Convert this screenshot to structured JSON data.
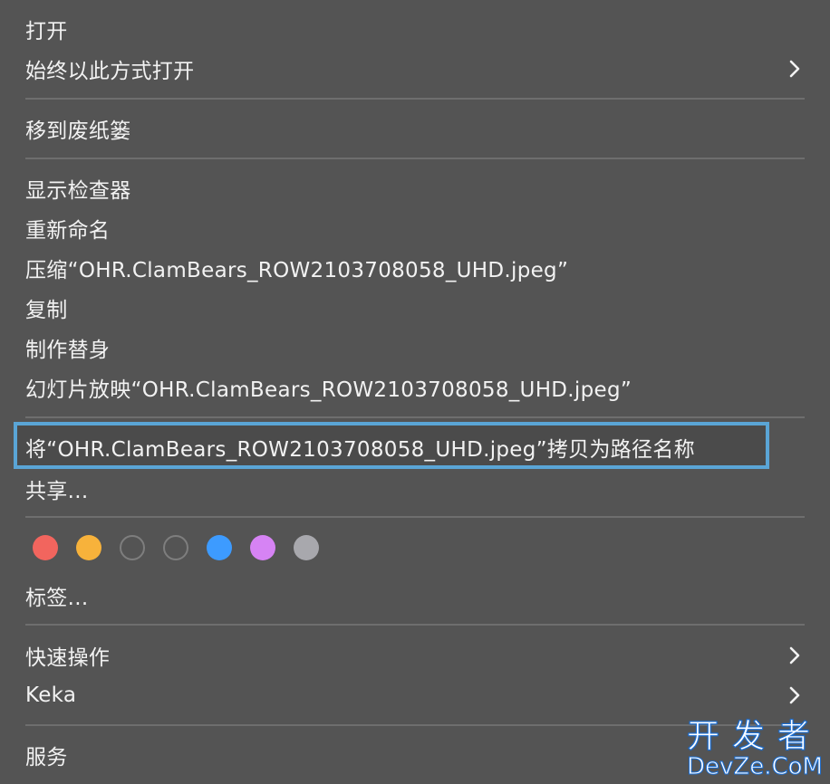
{
  "menu": {
    "items": [
      {
        "label": "打开"
      },
      {
        "label": "始终以此方式打开",
        "submenu": true
      },
      {
        "label": "移到废纸篓"
      },
      {
        "label": "显示检查器"
      },
      {
        "label": "重新命名"
      },
      {
        "label": "压缩“OHR.ClamBears_ROW2103708058_UHD.jpeg”"
      },
      {
        "label": "复制"
      },
      {
        "label": "制作替身"
      },
      {
        "label": "幻灯片放映“OHR.ClamBears_ROW2103708058_UHD.jpeg”"
      },
      {
        "label": "将“OHR.ClamBears_ROW2103708058_UHD.jpeg”拷贝为路径名称",
        "highlighted": true
      },
      {
        "label": "共享..."
      },
      {
        "label": "标签..."
      },
      {
        "label": "快速操作",
        "submenu": true
      },
      {
        "label": "Keka",
        "submenu": true
      },
      {
        "label": "服务"
      }
    ],
    "tag_colors": [
      {
        "name": "red",
        "color": "#f2655e",
        "filled": true
      },
      {
        "name": "orange",
        "color": "#f7b23b",
        "filled": true
      },
      {
        "name": "none-1",
        "color": "#7e7e7e",
        "filled": false
      },
      {
        "name": "none-2",
        "color": "#7e7e7e",
        "filled": false
      },
      {
        "name": "blue",
        "color": "#3d9bff",
        "filled": true
      },
      {
        "name": "purple",
        "color": "#d683f4",
        "filled": true
      },
      {
        "name": "gray",
        "color": "#a8a8ad",
        "filled": true
      }
    ],
    "highlight_color": "#5aa5d6"
  },
  "watermark": {
    "cn": "开发者",
    "en": "DevZe.CoM"
  }
}
